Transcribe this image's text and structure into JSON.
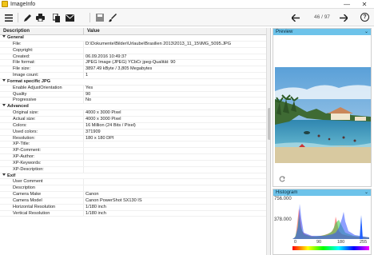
{
  "window": {
    "title": "ImageInfo",
    "minimize": "—",
    "close": "✕"
  },
  "toolbar": {
    "counter": "46 / 97",
    "help": "?"
  },
  "grid": {
    "header": {
      "description": "Description",
      "value": "Value"
    },
    "rows": [
      {
        "type": "group",
        "description": "General"
      },
      {
        "type": "item",
        "description": "File:",
        "value": "D:\\Dokumente\\Bilder\\Urlaube\\Brasilien 2013\\2013_11_15\\IMG_5095.JPG"
      },
      {
        "type": "item",
        "description": "Copyright:",
        "value": ""
      },
      {
        "type": "item",
        "description": "Created:",
        "value": "06.09.2016 10:49:37"
      },
      {
        "type": "item",
        "description": "File format:",
        "value": "JPEG Image (JPEG) YCbCr jpeg-Qualität: 90"
      },
      {
        "type": "item",
        "description": "File size:",
        "value": "3897.49 kByte / 3,805 Megabytes"
      },
      {
        "type": "item",
        "description": "Image count:",
        "value": "1"
      },
      {
        "type": "group",
        "description": "Format specific JPG"
      },
      {
        "type": "item",
        "description": "Enable AdjustOrientation",
        "value": "Yes"
      },
      {
        "type": "item",
        "description": "Quality",
        "value": "90"
      },
      {
        "type": "item",
        "description": "Progressive",
        "value": "No"
      },
      {
        "type": "group",
        "description": "Advanced"
      },
      {
        "type": "item",
        "description": "Original size:",
        "value": "4000 x 3000 Pixel"
      },
      {
        "type": "item",
        "description": "Actual size:",
        "value": "4000 x 3000 Pixel"
      },
      {
        "type": "item",
        "description": "Colors:",
        "value": "16 Million (24 Bits / Pixel)"
      },
      {
        "type": "item",
        "description": "Used colors:",
        "value": "371909"
      },
      {
        "type": "item",
        "description": "Resolution:",
        "value": "180 x 180 DPI"
      },
      {
        "type": "item",
        "description": "XP-Title:",
        "value": ""
      },
      {
        "type": "item",
        "description": "XP-Comment:",
        "value": ""
      },
      {
        "type": "item",
        "description": "XP-Author:",
        "value": ""
      },
      {
        "type": "item",
        "description": "XP-Keywords:",
        "value": ""
      },
      {
        "type": "item",
        "description": "XP-Description:",
        "value": ""
      },
      {
        "type": "group",
        "description": "Exif"
      },
      {
        "type": "item",
        "description": "User Comment",
        "value": ""
      },
      {
        "type": "item",
        "description": "Description",
        "value": ""
      },
      {
        "type": "item",
        "description": "Camera Make",
        "value": "Canon"
      },
      {
        "type": "item",
        "description": "Camera Model",
        "value": "Canon PowerShot SX130 IS"
      },
      {
        "type": "item",
        "description": "Horizontal Resolution",
        "value": "1/180 inch"
      },
      {
        "type": "item",
        "description": "Vertical Resolution",
        "value": "1/180 inch"
      }
    ]
  },
  "preview": {
    "title": "Preview",
    "chevron": "⌄"
  },
  "histogram": {
    "title": "Histogram",
    "chevron": "⌄",
    "y_max": "756.000",
    "y_mid": "378.000",
    "x_ticks": [
      "0",
      "90",
      "180",
      "255"
    ]
  }
}
